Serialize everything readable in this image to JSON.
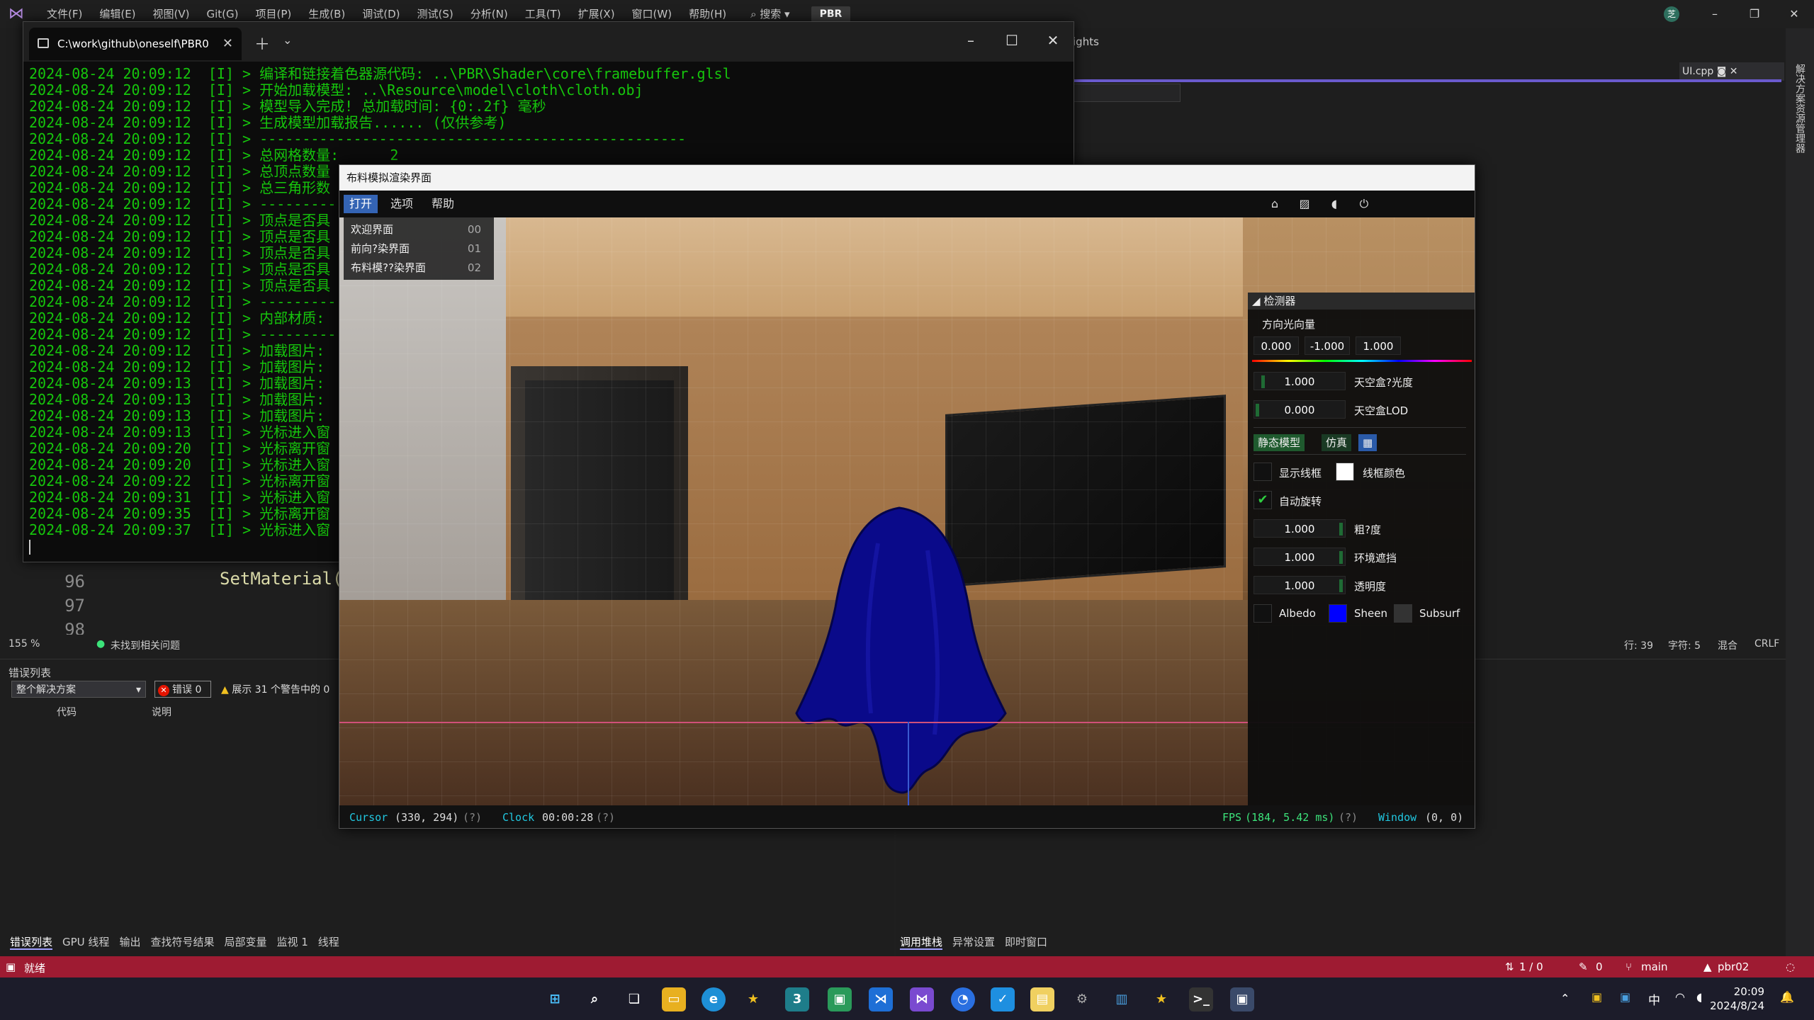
{
  "vs": {
    "menu": [
      "文件(F)",
      "编辑(E)",
      "视图(V)",
      "Git(G)",
      "项目(P)",
      "生成(B)",
      "调试(D)",
      "测试(S)",
      "分析(N)",
      "工具(T)",
      "扩展(X)",
      "窗口(W)",
      "帮助(H)"
    ],
    "search": "搜索",
    "solution": "PBR",
    "avatar": "芝",
    "behind_text": "ights",
    "doc_tab": "UI.cpp",
    "right_strip": "解决方案资源管理器",
    "code": {
      "lines": [
        "96",
        "97",
        "98"
      ],
      "text": "SetMaterial("
    },
    "editor_status": {
      "zoom": "155 %",
      "issues": "未找到相关问题",
      "line": "行: 39",
      "col": "字符: 5",
      "mix": "混合",
      "eol": "CRLF"
    },
    "error_panel": {
      "title": "错误列表",
      "scope": "整个解决方案",
      "errors": "错误 0",
      "warnings": "展示 31 个警告中的 0",
      "col_code": "代码",
      "col_desc": "说明"
    },
    "bottom_tabs_left": [
      "错误列表",
      "GPU 线程",
      "输出",
      "查找符号结果",
      "局部变量",
      "监视 1",
      "线程"
    ],
    "bottom_tabs_right": [
      "调用堆栈",
      "异常设置",
      "即时窗口"
    ],
    "status": {
      "ready": "就绪",
      "updown": "1 / 0",
      "pencil": "0",
      "branch": "main",
      "repo": "pbr02"
    }
  },
  "terminal": {
    "tab_title": "C:\\work\\github\\oneself\\PBR0",
    "lines": [
      "2024-08-24 20:09:12  [I] > 编译和链接着色器源代码: ..\\PBR\\Shader\\core\\framebuffer.glsl",
      "2024-08-24 20:09:12  [I] > 开始加载模型: ..\\Resource\\model\\cloth\\cloth.obj",
      "2024-08-24 20:09:12  [I] > 模型导入完成! 总加载时间: {0:.2f} 毫秒",
      "2024-08-24 20:09:12  [I] > 生成模型加载报告...... (仅供参考)",
      "2024-08-24 20:09:12  [I] > --------------------------------------------------",
      "2024-08-24 20:09:12  [I] > 总网格数量:      2",
      "2024-08-24 20:09:12  [I] > 总顶点数量",
      "2024-08-24 20:09:12  [I] > 总三角形数",
      "2024-08-24 20:09:12  [I] > ---------",
      "2024-08-24 20:09:12  [I] > 顶点是否具",
      "2024-08-24 20:09:12  [I] > 顶点是否具",
      "2024-08-24 20:09:12  [I] > 顶点是否具",
      "2024-08-24 20:09:12  [I] > 顶点是否具",
      "2024-08-24 20:09:12  [I] > 顶点是否具",
      "2024-08-24 20:09:12  [I] > ---------",
      "2024-08-24 20:09:12  [I] > 内部材质:",
      "2024-08-24 20:09:12  [I] > ---------",
      "2024-08-24 20:09:12  [I] > 加载图片:",
      "2024-08-24 20:09:12  [I] > 加载图片:",
      "2024-08-24 20:09:13  [I] > 加载图片:",
      "2024-08-24 20:09:13  [I] > 加载图片:",
      "2024-08-24 20:09:13  [I] > 加载图片:",
      "2024-08-24 20:09:13  [I] > 光标进入窗",
      "2024-08-24 20:09:20  [I] > 光标离开窗",
      "2024-08-24 20:09:20  [I] > 光标进入窗",
      "2024-08-24 20:09:22  [I] > 光标离开窗",
      "2024-08-24 20:09:31  [I] > 光标进入窗",
      "2024-08-24 20:09:35  [I] > 光标离开窗",
      "2024-08-24 20:09:37  [I] > 光标进入窗"
    ]
  },
  "app": {
    "title": "布料模拟渲染界面",
    "menu": [
      "打开",
      "选项",
      "帮助"
    ],
    "scene_menu": [
      {
        "label": "欢迎界面",
        "key": "00"
      },
      {
        "label": "前向?染界面",
        "key": "01"
      },
      {
        "label": "布料模??染界面",
        "key": "02"
      }
    ],
    "inspector": {
      "title": "检测器",
      "light_dir_label": "方向光向量",
      "light_dir": [
        "0.000",
        "-1.000",
        "1.000"
      ],
      "skybox_brightness": {
        "value": "1.000",
        "label": "天空盒?光度"
      },
      "skybox_lod": {
        "value": "0.000",
        "label": "天空盒LOD"
      },
      "tabs": [
        "静态模型",
        "仿真"
      ],
      "show_wireframe": "显示线框",
      "wire_color": "线框颜色",
      "auto_rotate": "自动旋转",
      "auto_rotate_checked": true,
      "roughness": {
        "value": "1.000",
        "label": "粗?度"
      },
      "ao": {
        "value": "1.000",
        "label": "环境遮挡"
      },
      "transparency": {
        "value": "1.000",
        "label": "透明度"
      },
      "albedo": "Albedo",
      "sheen": "Sheen",
      "subsurf": "Subsurf",
      "sheen_color": "#0000ff",
      "wire_color_value": "#ffffff"
    },
    "status": {
      "cursor_label": "Cursor",
      "cursor_value": "(330, 294)",
      "clock_label": "Clock",
      "clock_value": "00:00:28",
      "fps_label": "FPS",
      "fps_value": "(184, 5.42 ms)",
      "window_label": "Window",
      "window_value": "(0, 0)",
      "help": "(?)"
    }
  },
  "taskbar": {
    "time": "20:09",
    "date": "2024/8/24",
    "ime": "中"
  }
}
